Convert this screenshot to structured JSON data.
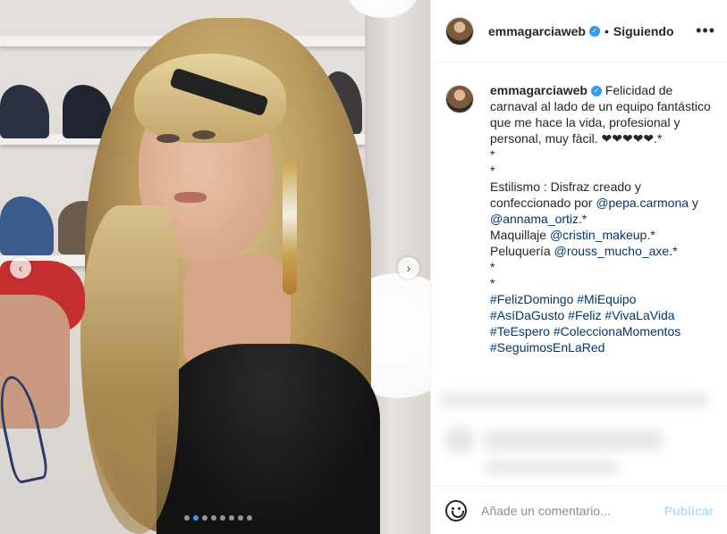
{
  "post": {
    "carousel": {
      "prev_icon": "chevron-left-icon",
      "next_icon": "chevron-right-icon",
      "prev_glyph": "‹",
      "next_glyph": "›",
      "slide_count": 8,
      "active_slide": 2
    }
  },
  "header": {
    "username": "emmagarciaweb",
    "separator": "•",
    "follow_status": "Siguiendo",
    "more_glyph": "•••",
    "verified_glyph": "✓"
  },
  "caption": {
    "username": "emmagarciaweb",
    "text_1": " Felicidad de carnaval al lado de un equipo fantástico que me hace la vida, profesional y personal, muy fàcil. ❤❤❤❤❤.*\n*\n*\nEstilismo : Disfraz creado y confeccionado por ",
    "mention_1": "@pepa.carmona",
    "text_2": " y ",
    "mention_2": "@annama_ortiz",
    "text_3": ".*\nMaquillaje ",
    "mention_3": "@cristin_makeup",
    "text_4": ".*\nPeluquería ",
    "mention_4": "@rouss_mucho_axe",
    "text_5": ".*\n*\n*\n",
    "hashtag_1": "#FelizDomingo",
    "hashtag_2": "#MiEquipo",
    "hashtag_3": "#AsíDaGusto",
    "hashtag_4": "#Feliz",
    "hashtag_5": "#VivaLaVida",
    "hashtag_6": "#TeEspero",
    "hashtag_7": "#ColeccionaMomentos",
    "hashtag_8": "#SeguimosEnLaRed"
  },
  "comment_bar": {
    "emoji_icon": "smiley-icon",
    "placeholder": "Añade un comentario...",
    "publish_label": "Publicar"
  },
  "colors": {
    "accent": "#3897f0",
    "link": "#00376b",
    "publish_disabled": "#b2dffc"
  }
}
